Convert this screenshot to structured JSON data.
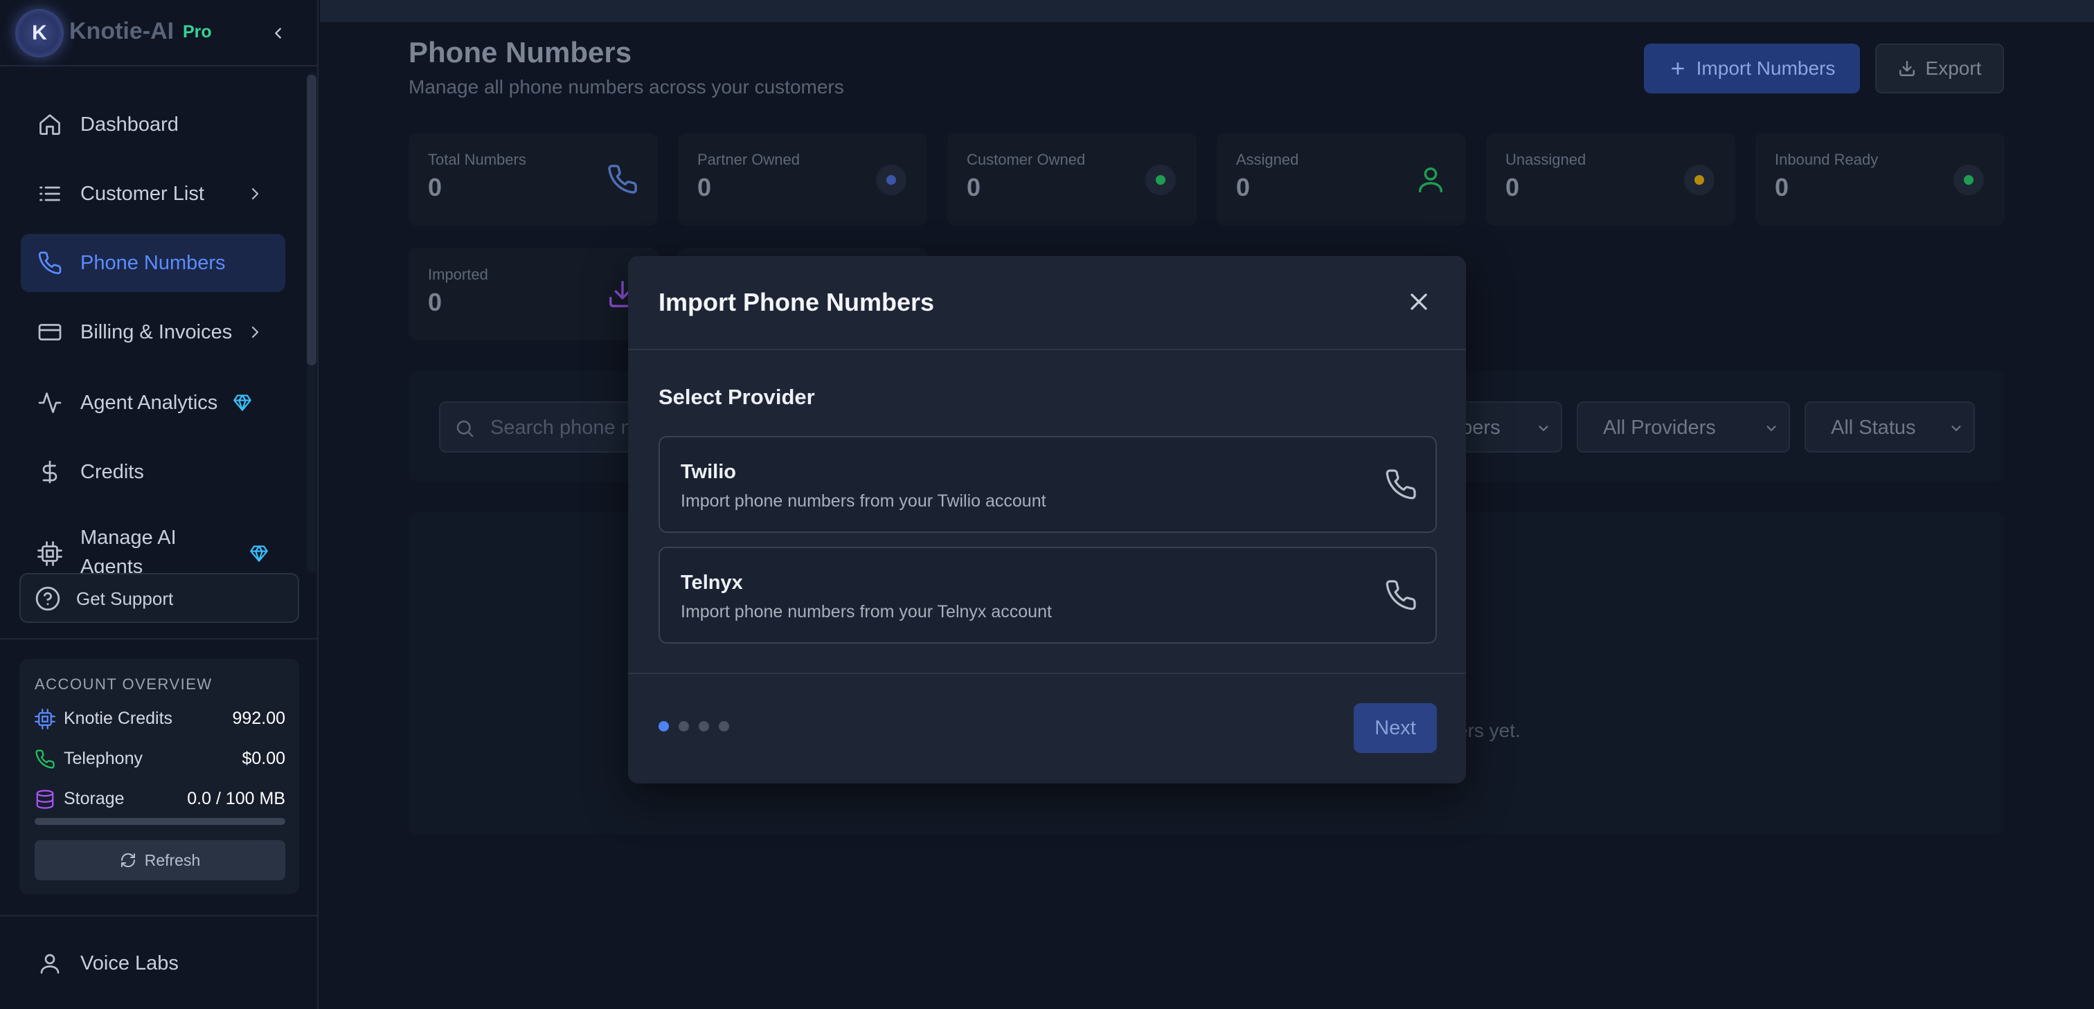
{
  "brand": {
    "logo_letter": "K",
    "name": "Knotie-AI",
    "tier": "Pro"
  },
  "sidebar": {
    "items": [
      {
        "label": "Dashboard",
        "icon": "home-icon"
      },
      {
        "label": "Customer List",
        "icon": "list-icon",
        "has_submenu": true
      },
      {
        "label": "Phone Numbers",
        "icon": "phone-icon",
        "active": true
      },
      {
        "label": "Billing & Invoices",
        "icon": "credit-card-icon",
        "has_submenu": true
      },
      {
        "label": "Agent Analytics",
        "icon": "activity-icon",
        "premium": true
      },
      {
        "label": "Credits",
        "icon": "dollar-icon"
      },
      {
        "label": "Manage AI Agents",
        "icon": "cpu-icon",
        "premium": true
      }
    ],
    "support_label": "Get Support",
    "voice_labs_label": "Voice Labs"
  },
  "account": {
    "title": "ACCOUNT OVERVIEW",
    "rows": [
      {
        "label": "Knotie Credits",
        "value": "992.00",
        "icon": "cpu-icon"
      },
      {
        "label": "Telephony",
        "value": "$0.00",
        "icon": "phone-icon"
      },
      {
        "label": "Storage",
        "value": "0.0 / 100 MB",
        "icon": "database-icon"
      }
    ],
    "storage_used_fraction": 0.0,
    "refresh_label": "Refresh"
  },
  "header": {
    "title": "Phone Numbers",
    "subtitle": "Manage all phone numbers across your customers",
    "import_label": "Import Numbers",
    "export_label": "Export"
  },
  "stats": [
    {
      "label": "Total Numbers",
      "value": "0",
      "icon": "phone-icon",
      "color": "#4f82f7"
    },
    {
      "label": "Partner Owned",
      "value": "0",
      "icon": "dot",
      "color": "#4f6fd6"
    },
    {
      "label": "Customer Owned",
      "value": "0",
      "icon": "dot",
      "color": "#22c55e"
    },
    {
      "label": "Assigned",
      "value": "0",
      "icon": "user-icon",
      "color": "#22c55e"
    },
    {
      "label": "Unassigned",
      "value": "0",
      "icon": "dot",
      "color": "#eab308"
    },
    {
      "label": "Inbound Ready",
      "value": "0",
      "icon": "dot",
      "color": "#22c55e"
    },
    {
      "label": "Imported",
      "value": "0",
      "icon": "download-icon",
      "color": "#a855f7"
    }
  ],
  "filters": {
    "search_placeholder": "Search phone n",
    "type_value": "mbers",
    "provider_value": "All Providers",
    "status_value": "All Status"
  },
  "empty_state": "ers yet.",
  "modal": {
    "title": "Import Phone Numbers",
    "section_title": "Select Provider",
    "providers": [
      {
        "name": "Twilio",
        "description": "Import phone numbers from your Twilio account"
      },
      {
        "name": "Telnyx",
        "description": "Import phone numbers from your Telnyx account"
      }
    ],
    "step_count": 4,
    "current_step": 1,
    "next_label": "Next"
  },
  "colors": {
    "accent": "#4f82f7",
    "success": "#22c55e",
    "warning": "#eab308",
    "premium": "#38bdf8"
  }
}
